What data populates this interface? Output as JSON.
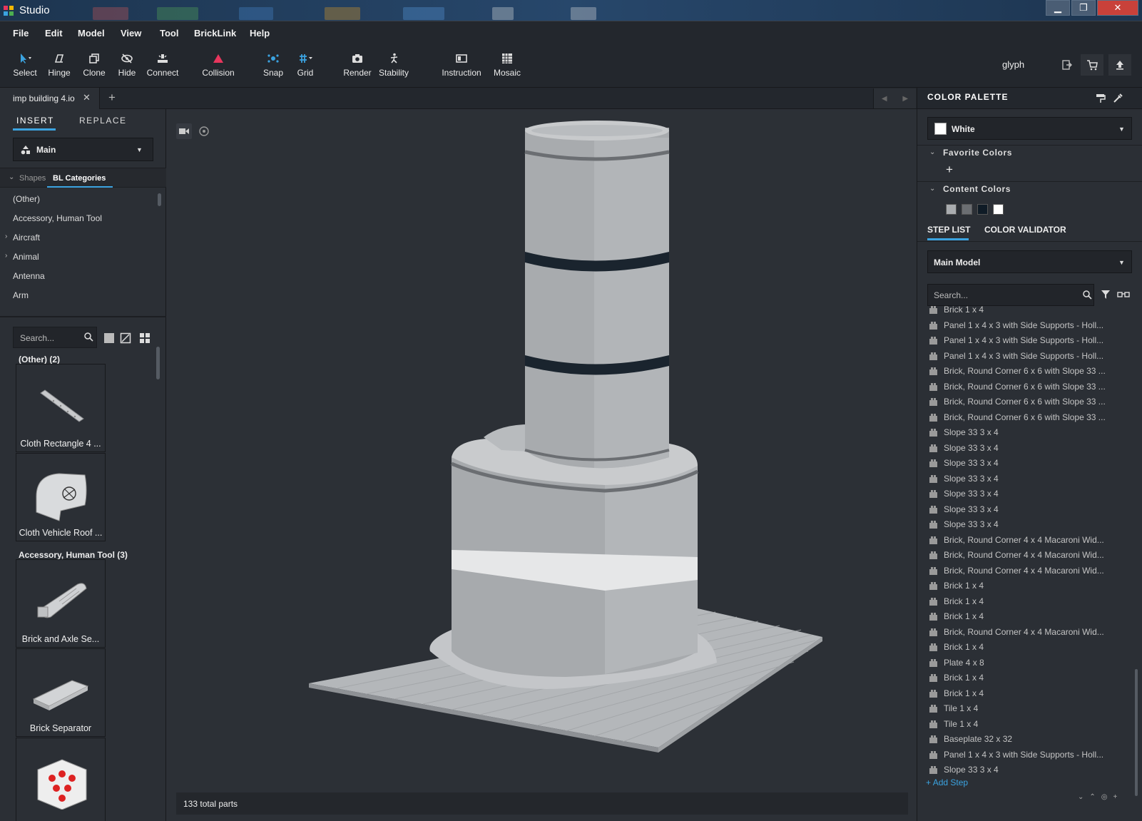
{
  "window": {
    "title": "Studio"
  },
  "menu": [
    "File",
    "Edit",
    "Model",
    "View",
    "Tool",
    "BrickLink",
    "Help"
  ],
  "toolbar": {
    "select": "Select",
    "hinge": "Hinge",
    "clone": "Clone",
    "hide": "Hide",
    "connect": "Connect",
    "collision": "Collision",
    "snap": "Snap",
    "grid": "Grid",
    "render": "Render",
    "stability": "Stability",
    "instruction": "Instruction",
    "mosaic": "Mosaic",
    "user": "glyph"
  },
  "file_tab": {
    "name": "imp building 4.io",
    "close": "✕",
    "add": "+"
  },
  "left": {
    "tabs": {
      "insert": "INSERT",
      "replace": "REPLACE"
    },
    "model_select": "Main",
    "category_tabs": {
      "shapes": "Shapes",
      "bl": "BL Categories"
    },
    "categories": [
      {
        "label": "(Other)",
        "arrow": ""
      },
      {
        "label": "Accessory, Human Tool",
        "arrow": ""
      },
      {
        "label": "Aircraft",
        "arrow": "›"
      },
      {
        "label": "Animal",
        "arrow": "›"
      },
      {
        "label": "Antenna",
        "arrow": ""
      },
      {
        "label": "Arm",
        "arrow": ""
      }
    ],
    "search_placeholder": "Search...",
    "groups": [
      {
        "title": "(Other) (2)"
      },
      {
        "title": "Accessory, Human Tool (3)"
      }
    ],
    "parts": [
      "Cloth Rectangle 4 ...",
      "Cloth Vehicle Roof ...",
      "Brick and Axle Se...",
      "Brick Separator",
      ""
    ]
  },
  "viewport": {
    "status": "133 total parts"
  },
  "right": {
    "palette_title": "COLOR PALETTE",
    "selected_color": "White",
    "favorite_colors": "Favorite Colors",
    "add": "+",
    "content_colors": "Content Colors",
    "content_swatches": [
      "#a9acaf",
      "#6b6e72",
      "#0f1b26",
      "#ffffff"
    ],
    "tabs": {
      "step_list": "STEP LIST",
      "color_validator": "COLOR VALIDATOR"
    },
    "model": "Main Model",
    "search_placeholder": "Search...",
    "steps": [
      "Brick 1 x 4",
      "Panel 1 x 4 x 3 with Side Supports - Holl...",
      "Panel 1 x 4 x 3 with Side Supports - Holl...",
      "Panel 1 x 4 x 3 with Side Supports - Holl...",
      "Brick, Round Corner 6 x 6 with Slope 33 ...",
      "Brick, Round Corner 6 x 6 with Slope 33 ...",
      "Brick, Round Corner 6 x 6 with Slope 33 ...",
      "Brick, Round Corner 6 x 6 with Slope 33 ...",
      "Slope 33 3 x 4",
      "Slope 33 3 x 4",
      "Slope 33 3 x 4",
      "Slope 33 3 x 4",
      "Slope 33 3 x 4",
      "Slope 33 3 x 4",
      "Slope 33 3 x 4",
      "Brick, Round Corner 4 x 4 Macaroni Wid...",
      "Brick, Round Corner 4 x 4 Macaroni Wid...",
      "Brick, Round Corner 4 x 4 Macaroni Wid...",
      "Brick 1 x 4",
      "Brick 1 x 4",
      "Brick 1 x 4",
      "Brick, Round Corner 4 x 4 Macaroni Wid...",
      "Brick 1 x 4",
      "Plate 4 x 8",
      "Brick 1 x 4",
      "Brick 1 x 4",
      "Tile 1 x 4",
      "Tile 1 x 4",
      "Baseplate 32 x 32",
      "Panel 1 x 4 x 3 with Side Supports - Holl...",
      "Slope 33 3 x 4"
    ],
    "add_step": "Add Step"
  },
  "colors": {
    "accent": "#3ba3e0",
    "collision": "#e8365d",
    "snap": "#3ba3e0"
  }
}
